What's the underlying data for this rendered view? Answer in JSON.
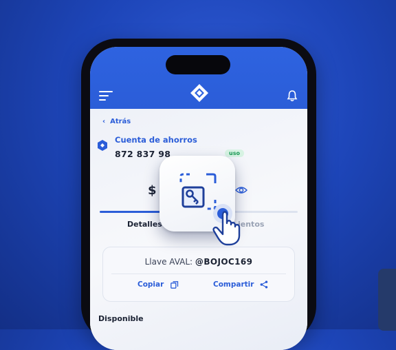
{
  "header": {
    "menu_icon": "menu-icon",
    "logo_icon": "brand-logo-icon",
    "bell_icon": "bell-icon"
  },
  "nav": {
    "back_label": "Atrás"
  },
  "account": {
    "title": "Cuenta de ahorros",
    "number": "872 837 98",
    "badge": "uso"
  },
  "balance": {
    "prefix": "$"
  },
  "tabs": {
    "left": "Detalles",
    "right": "ientos"
  },
  "key_card": {
    "label": "Llave AVAL:",
    "value": "@BOJOC169",
    "copy_label": "Copiar",
    "share_label": "Compartir"
  },
  "available_label": "Disponible",
  "colors": {
    "accent": "#2b5dd8",
    "background": "#1d45b8",
    "badge_green": "#1a9a55"
  }
}
